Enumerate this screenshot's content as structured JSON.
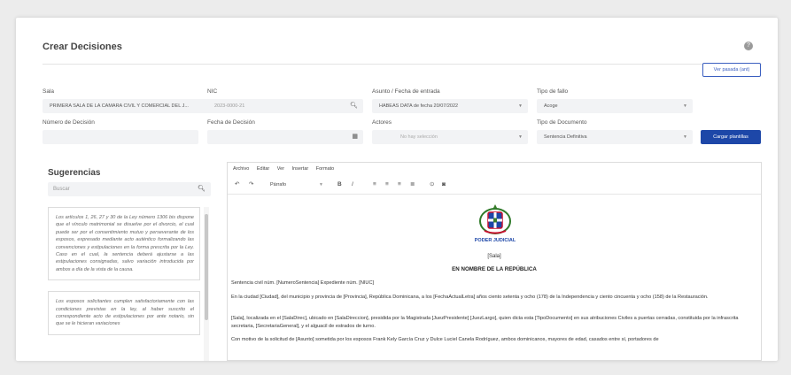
{
  "page": {
    "title": "Crear Decisiones",
    "help_glyph": "?",
    "view_button": "Ver pasada (ant)"
  },
  "form": {
    "sala": {
      "label": "Sala",
      "value": "PRIMERA SALA DE LA CAMARA CIVIL Y COMERCIAL DEL J..."
    },
    "nic": {
      "label": "NIC",
      "value": "2023-0000-21"
    },
    "asunto": {
      "label": "Asunto / Fecha de entrada",
      "value": "HABEAS DATA de fecha 20/07/2022"
    },
    "tipo_fallo": {
      "label": "Tipo de fallo",
      "value": "Acoge"
    },
    "numero_decision": {
      "label": "Número de Decisión",
      "value": ""
    },
    "fecha_decision": {
      "label": "Fecha de Decisión",
      "value": ""
    },
    "actores": {
      "label": "Actores",
      "placeholder": "No hay selección"
    },
    "tipo_documento": {
      "label": "Tipo de Documento",
      "value": "Sentencia Definitiva"
    },
    "load_button": "Cargar plantillas"
  },
  "suggestions": {
    "title": "Sugerencias",
    "search_placeholder": "Buscar",
    "items": [
      "Los artículos 1, 26, 27 y 30 de la Ley número 1306 bis dispone que el vínculo matrimonial se disuelve por el divorcio, el cual puede ser por el consentimiento mutuo y perseverante de los esposos, expresado mediante acto auténtico formalizando las convenciones y estipulaciones en la forma prescrita por la Ley. Caso en el cual, la sentencia deberá ajustarse a las estipulaciones consignadas, salvo variación introducida por ambos a día de la vista de la causa.",
      "Los esposos solicitantes cumplen satisfactoriamente con las condiciones previstas en la ley, al haber suscrito el correspondiente acto de estipulaciones por ante notario, sin que se le hicieran variaciones"
    ]
  },
  "editor": {
    "menu": [
      "Archivo",
      "Editar",
      "Ver",
      "Insertar",
      "Formato"
    ],
    "format_select": "Párrafo",
    "seal_label": "PODER JUDICIAL",
    "sala_tag": "[Sala]",
    "heading": "EN NOMBRE DE LA REPÚBLICA",
    "paragraphs": [
      "Sentencia civil núm. [NumeroSentencia] Expediente núm. [NIUC]",
      "En la ciudad [Ciudad], del municipio y provincia de [Provincia], República Dominicana, a los [FechaActualLetra] años ciento setenta y ocho (178) de la Independencia y ciento cincuenta y ocho (158) de la Restauración.",
      "[Sala], localizada en el [SalaDirec], ubicado en [SalaDireccion], presidida por la Magistrada [JuezPresidente] [JuezLargo], quien dicta esta [TipoDocumento] en sus atribuciones Civiles a puertas cerradas, constituida por la infrascrita secretaria, [SecretariaGeneral], y el alguacil de estrados de turno.",
      "Con motivo de la solicitud de [Asunto] sometida por los esposos Frank Kely García Cruz y Dulce Luciel Canela Rodríguez, ambos dominicanos, mayores de edad, casados entre sí, portadores de"
    ]
  },
  "colors": {
    "primary": "#1d47a8",
    "background": "#ececec"
  }
}
